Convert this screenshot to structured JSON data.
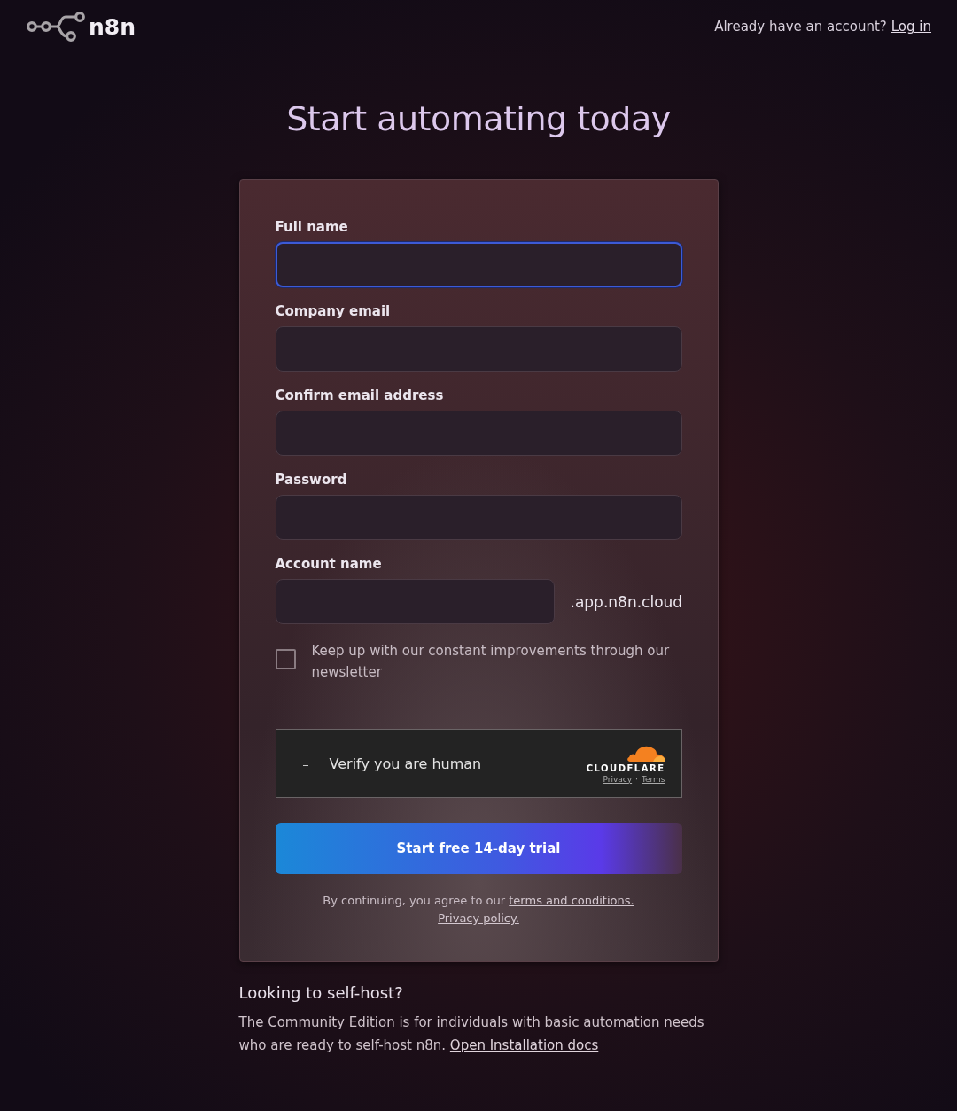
{
  "header": {
    "logo": "n8n",
    "prompt": "Already have an account?",
    "login_link": "Log in"
  },
  "title": "Start automating today",
  "form": {
    "fields": [
      {
        "label": "Full name",
        "focused": true
      },
      {
        "label": "Company email",
        "focused": false
      },
      {
        "label": "Confirm email address",
        "focused": false
      },
      {
        "label": "Password",
        "focused": false
      },
      {
        "label": "Account name",
        "focused": false,
        "suffix": ".app.n8n.cloud"
      }
    ],
    "newsletter": {
      "label": "Keep up with our constant improvements through our newsletter",
      "checked": false
    },
    "captcha": {
      "text": "Verify you are human",
      "brand": "CLOUDFLARE",
      "privacy": "Privacy",
      "separator": "·",
      "terms": "Terms"
    },
    "submit": "Start free 14-day trial",
    "legal": {
      "text": "By continuing, you agree to our",
      "terms_link": "terms and conditions.",
      "privacy_link": "Privacy policy."
    }
  },
  "self_host": {
    "heading": "Looking to self-host?",
    "text": "The Community Edition is for individuals with basic automation needs who are ready to self-host n8n.",
    "link": "Open Installation docs"
  }
}
